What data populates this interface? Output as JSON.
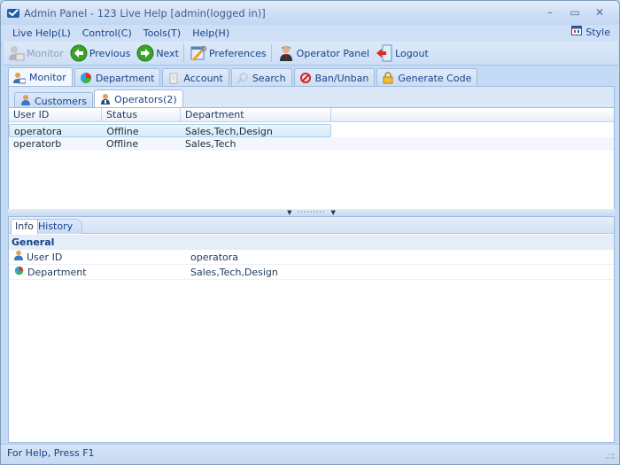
{
  "window": {
    "title": "Admin Panel - 123 Live Help [admin(logged in)]",
    "controls": {
      "minimize": "–",
      "maximize": "▭",
      "close": "✕"
    }
  },
  "menubar": {
    "items": [
      {
        "label": "Live Help(L)"
      },
      {
        "label": "Control(C)"
      },
      {
        "label": "Tools(T)"
      },
      {
        "label": "Help(H)"
      }
    ],
    "style_label": "Style"
  },
  "toolbar": {
    "buttons": [
      {
        "label": "Monitor",
        "icon": "monitor-user-icon",
        "enabled": false
      },
      {
        "label": "Previous",
        "icon": "arrow-left-icon",
        "enabled": true
      },
      {
        "label": "Next",
        "icon": "arrow-right-icon",
        "enabled": true
      },
      {
        "label": "Preferences",
        "icon": "preferences-tools-icon",
        "enabled": true
      },
      {
        "label": "Operator Panel",
        "icon": "operator-icon",
        "enabled": true
      },
      {
        "label": "Logout",
        "icon": "logout-door-icon",
        "enabled": true
      }
    ]
  },
  "main_tabs": [
    {
      "label": "Monitor",
      "icon": "monitor-user-icon",
      "active": true
    },
    {
      "label": "Department",
      "icon": "pie-chart-icon",
      "active": false
    },
    {
      "label": "Account",
      "icon": "notepad-icon",
      "active": false
    },
    {
      "label": "Search",
      "icon": "magnifier-icon",
      "active": false
    },
    {
      "label": "Ban/Unban",
      "icon": "ban-icon",
      "active": false
    },
    {
      "label": "Generate Code",
      "icon": "lock-icon",
      "active": false
    }
  ],
  "sub_tabs": [
    {
      "label": "Customers",
      "icon": "user-icon",
      "active": false
    },
    {
      "label": "Operators(2)",
      "icon": "operator-user-icon",
      "active": true
    }
  ],
  "operators_table": {
    "columns": [
      "User ID",
      "Status",
      "Department"
    ],
    "rows": [
      {
        "user_id": "operatora",
        "status": "Offline",
        "department": "Sales,Tech,Design",
        "selected": true
      },
      {
        "user_id": "operatorb",
        "status": "Offline",
        "department": "Sales,Tech",
        "selected": false
      }
    ]
  },
  "detail_tabs": [
    {
      "label": "Info",
      "active": true
    },
    {
      "label": "History",
      "active": false
    }
  ],
  "property_grid": {
    "section": "General",
    "rows": [
      {
        "name": "User ID",
        "value": "operatora",
        "icon": "user-icon"
      },
      {
        "name": "Department",
        "value": "Sales,Tech,Design",
        "icon": "pie-chart-icon"
      }
    ]
  },
  "statusbar": {
    "text": "For Help, Press F1"
  },
  "colors": {
    "accent_text": "#15428b",
    "frame": "#c4daf5",
    "selection": "#d6ecf8"
  }
}
